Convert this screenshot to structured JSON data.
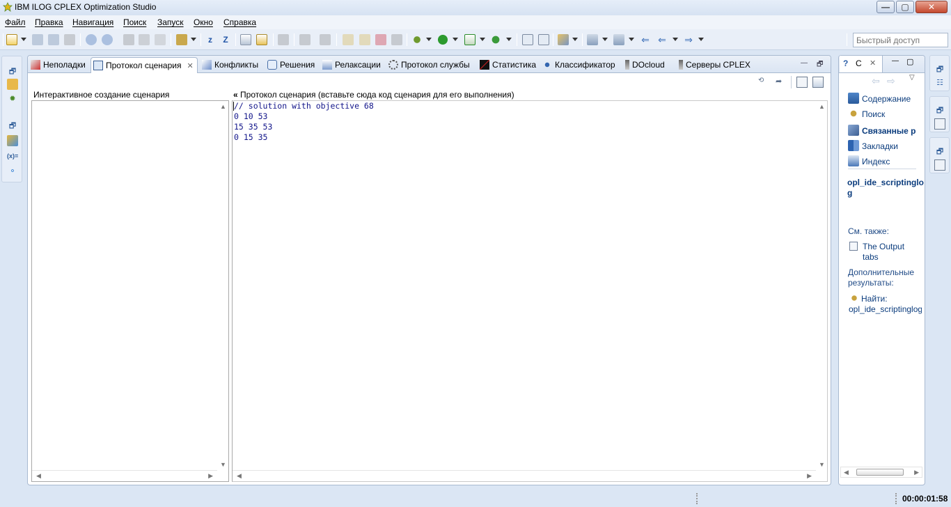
{
  "window": {
    "title": "IBM ILOG CPLEX Optimization Studio",
    "min": "—",
    "max": "▢",
    "close": "✕"
  },
  "menu": [
    "Файл",
    "Правка",
    "Навигация",
    "Поиск",
    "Запуск",
    "Окно",
    "Справка"
  ],
  "quick_access": {
    "placeholder": "Быстрый доступ"
  },
  "tabs": [
    {
      "label": "Неполадки"
    },
    {
      "label": "Протокол сценария",
      "close": "✕"
    },
    {
      "label": "Конфликты"
    },
    {
      "label": "Решения"
    },
    {
      "label": "Релаксации"
    },
    {
      "label": "Протокол службы"
    },
    {
      "label": "Статистика"
    },
    {
      "label": "Классификатор"
    },
    {
      "label": "DOcloud"
    },
    {
      "label": "Серверы CPLEX"
    }
  ],
  "script_log": {
    "left_label": "Интерактивное создание сценария",
    "collapse": "«",
    "right_label": "Протокол сценария (вставьте сюда код сценария для его выполнения)",
    "code": "// solution with objective 68\n0 10 53\n15 35 53\n0 15 35"
  },
  "help": {
    "tab_label": "С",
    "tab_close": "✕",
    "items": [
      "Содержание",
      "Поиск",
      "Связанные р",
      "Закладки",
      "Индекс"
    ],
    "topic_title": "opl_ide_scriptinglog",
    "see_also": "См. также:",
    "link": "The Output tabs",
    "more": "Дополнительные результаты:",
    "find": "Найти:",
    "find_term": "opl_ide_scriptinglog"
  },
  "status": {
    "timer": "00:00:01:58"
  }
}
